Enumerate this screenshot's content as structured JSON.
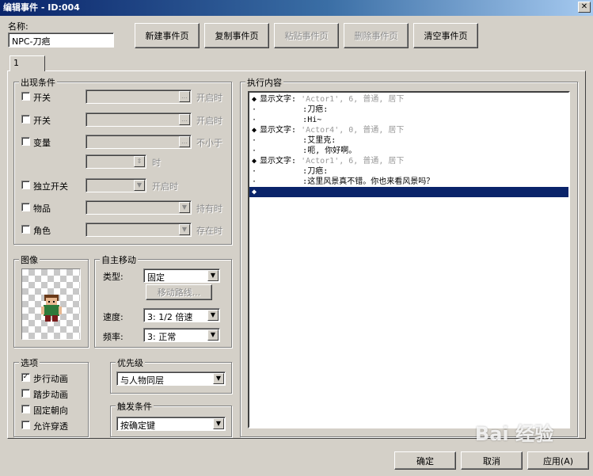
{
  "window": {
    "title": "编辑事件 - ID:004",
    "close_glyph": "✕"
  },
  "name_field": {
    "label": "名称:",
    "value": "NPC-刀疤"
  },
  "toolbar": {
    "new_page": "新建事件页",
    "copy_page": "复制事件页",
    "paste_page": "粘贴事件页",
    "delete_page": "删除事件页",
    "clear_page": "清空事件页"
  },
  "tabs": [
    "1"
  ],
  "conditions": {
    "title": "出现条件",
    "switch1": {
      "label": "开关",
      "suffix": "开启时"
    },
    "switch2": {
      "label": "开关",
      "suffix": "开启时"
    },
    "variable": {
      "label": "变量",
      "suffix": "不小于",
      "suffix2": "时"
    },
    "self_switch": {
      "label": "独立开关",
      "suffix": "开启时"
    },
    "item": {
      "label": "物品",
      "suffix": "持有时"
    },
    "actor": {
      "label": "角色",
      "suffix": "存在时"
    }
  },
  "image": {
    "title": "图像"
  },
  "autonomous": {
    "title": "自主移动",
    "type_label": "类型:",
    "type_value": "固定",
    "route_button": "移动路线...",
    "speed_label": "速度:",
    "speed_value": "3: 1/2 倍速",
    "freq_label": "频率:",
    "freq_value": "3: 正常"
  },
  "options": {
    "title": "选项",
    "walking_anim": {
      "label": "步行动画",
      "checked": true
    },
    "stepping_anim": {
      "label": "踏步动画",
      "checked": false
    },
    "direction_fix": {
      "label": "固定朝向",
      "checked": false
    },
    "through": {
      "label": "允许穿透",
      "checked": false
    }
  },
  "priority": {
    "title": "优先级",
    "value": "与人物同层"
  },
  "trigger": {
    "title": "触发条件",
    "value": "按确定键"
  },
  "contents": {
    "title": "执行内容",
    "lines": [
      {
        "mark": "◆",
        "text": "显示文字:",
        "params": "'Actor1', 6, 普通, 居下"
      },
      {
        "mark": "·",
        "text": "         :",
        "params": "刀疤:"
      },
      {
        "mark": "·",
        "text": "         :",
        "params": "Hi~"
      },
      {
        "mark": "◆",
        "text": "显示文字:",
        "params": "'Actor4', 0, 普通, 居下"
      },
      {
        "mark": "·",
        "text": "         :",
        "params": "艾里克:"
      },
      {
        "mark": "·",
        "text": "         :",
        "params": "呃, 你好啊。"
      },
      {
        "mark": "◆",
        "text": "显示文字:",
        "params": "'Actor1', 6, 普通, 居下"
      },
      {
        "mark": "·",
        "text": "         :",
        "params": "刀疤:"
      },
      {
        "mark": "·",
        "text": "         :",
        "params": "这里风景真不错。你也来看风景吗？"
      }
    ],
    "selected": "◆"
  },
  "footer": {
    "ok": "确定",
    "cancel": "取消",
    "apply": "应用(A)"
  },
  "watermark": "Bai 经验"
}
